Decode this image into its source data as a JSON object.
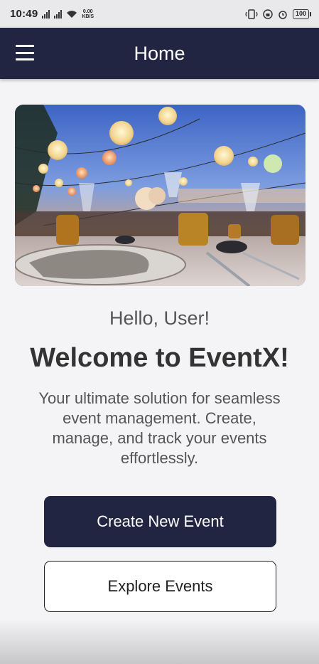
{
  "status_bar": {
    "time": "10:49",
    "net_speed_value": "0.00",
    "net_speed_unit": "KB/S",
    "battery": "100"
  },
  "app_bar": {
    "title": "Home",
    "bg_color": "#212542"
  },
  "hero": {
    "alt": "Outdoor dinner table with string lanterns at dusk"
  },
  "content": {
    "greeting": "Hello, User!",
    "welcome": "Welcome to EventX!",
    "tagline": "Your ultimate solution for seamless event management. Create, manage, and track your events effortlessly."
  },
  "actions": {
    "create_label": "Create New Event",
    "explore_label": "Explore Events"
  }
}
